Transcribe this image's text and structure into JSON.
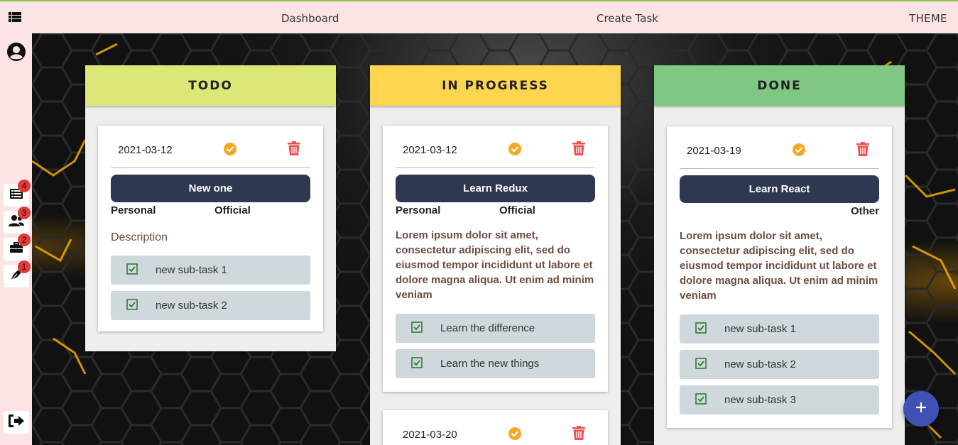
{
  "topbar": {
    "nav_dashboard": "Dashboard",
    "nav_create_task": "Create Task",
    "nav_theme": "THEME"
  },
  "sidebar": {
    "badges": {
      "tasks": "4",
      "users": "3",
      "work": "2",
      "notes": "1"
    }
  },
  "colors": {
    "todo_header": "#dde776",
    "in_progress_header": "#ffd54f",
    "done_header": "#81c784",
    "title_button": "#2e3850",
    "accent_check": "#f9a825",
    "delete": "#ef5350",
    "fab": "#3f51b5"
  },
  "columns": [
    {
      "title": "TODO",
      "cards": [
        {
          "date": "2021-03-12",
          "title": "New one",
          "tags": [
            "Personal",
            "Official"
          ],
          "description": "Description",
          "subtasks": [
            "new sub-task 1",
            "new sub-task 2"
          ]
        }
      ]
    },
    {
      "title": "IN PROGRESS",
      "cards": [
        {
          "date": "2021-03-12",
          "title": "Learn Redux",
          "tags": [
            "Personal",
            "Official"
          ],
          "description": "Lorem ipsum dolor sit amet, consectetur adipiscing elit, sed do eiusmod tempor incididunt ut labore et dolore magna aliqua. Ut enim ad minim veniam",
          "subtasks": [
            "Learn the difference",
            "Learn the new things"
          ]
        },
        {
          "date": "2021-03-20"
        }
      ]
    },
    {
      "title": "DONE",
      "cards": [
        {
          "date": "2021-03-19",
          "title": "Learn React",
          "tags": [
            "Other"
          ],
          "description": "Lorem ipsum dolor sit amet, consectetur adipiscing elit, sed do eiusmod tempor incididunt ut labore et dolore magna aliqua. Ut enim ad minim veniam",
          "subtasks": [
            "new sub-task 1",
            "new sub-task 2",
            "new sub-task 3"
          ]
        }
      ]
    }
  ]
}
